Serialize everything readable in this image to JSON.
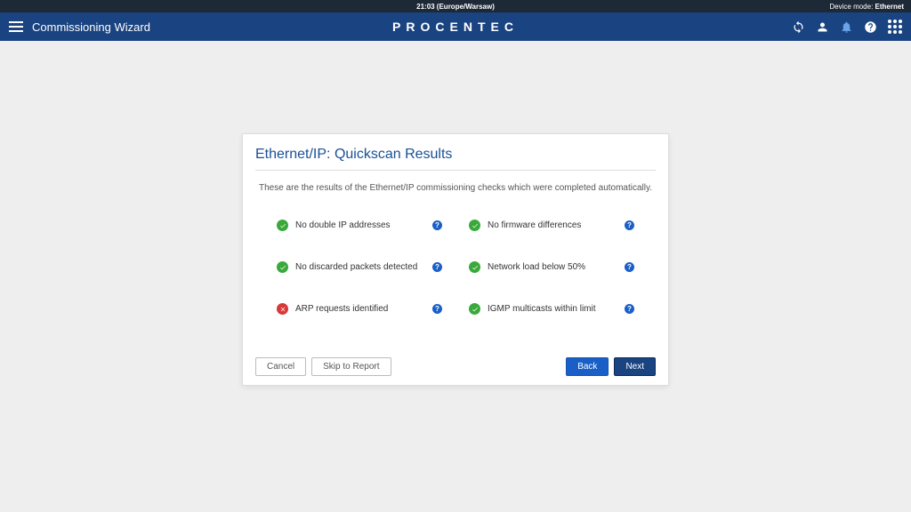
{
  "top": {
    "time": "21:03 (Europe/Warsaw)",
    "device_mode_label": "Device mode:",
    "device_mode_value": "Ethernet"
  },
  "header": {
    "page_title": "Commissioning Wizard",
    "logo": "PROCENTEC"
  },
  "card": {
    "title": "Ethernet/IP: Quickscan Results",
    "description": "These are the results of the Ethernet/IP commissioning checks which were completed automatically.",
    "results": [
      {
        "status": "pass",
        "label": "No double IP addresses"
      },
      {
        "status": "pass",
        "label": "No firmware differences"
      },
      {
        "status": "pass",
        "label": "No discarded packets detected"
      },
      {
        "status": "pass",
        "label": "Network load below 50%"
      },
      {
        "status": "fail",
        "label": "ARP requests identified"
      },
      {
        "status": "pass",
        "label": "IGMP multicasts within limit"
      }
    ],
    "buttons": {
      "cancel": "Cancel",
      "skip": "Skip to Report",
      "back": "Back",
      "next": "Next"
    }
  }
}
